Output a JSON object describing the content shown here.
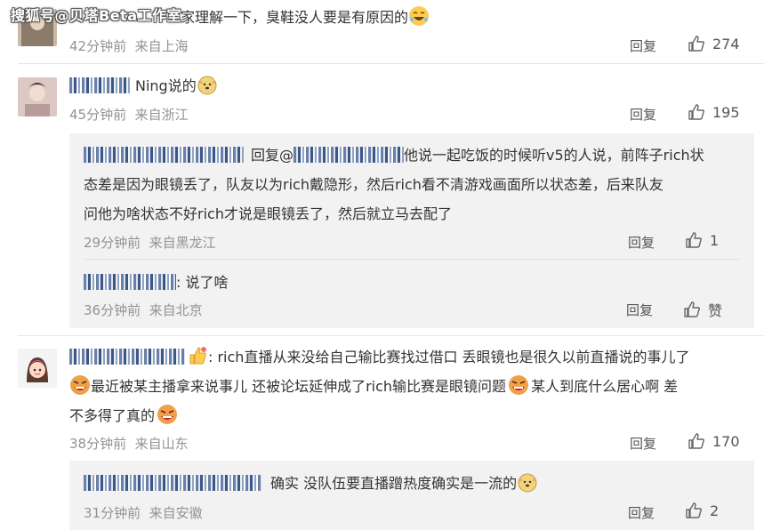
{
  "watermark": "搜狐号@贝塔Beta工作室",
  "actions": {
    "reply_label": "回复",
    "like_label": "赞"
  },
  "comments": [
    {
      "text": "家理解一下，臭鞋没人要是有原因的",
      "time": "42分钟前",
      "location": "来自上海",
      "likes": "274"
    },
    {
      "suffix": "Ning说的",
      "time": "45分钟前",
      "location": "来自浙江",
      "likes": "195",
      "replies": [
        {
          "reply_prefix": "回复@",
          "line1": "他说一起吃饭的时候听v5的人说，前阵子rich状",
          "line2": "态差是因为眼镜丢了，队友以为rich戴隐形，然后rich看不清游戏画面所以状态差，后来队友",
          "line3": "问他为啥状态不好rich才说是眼镜丢了，然后就立马去配了",
          "time": "29分钟前",
          "location": "来自黑龙江",
          "likes": "1"
        },
        {
          "text": ": 说了啥",
          "time": "36分钟前",
          "location": "来自北京"
        }
      ]
    },
    {
      "line1": ": rich直播从来没给自己输比赛找过借口 丢眼镜也是很久以前直播说的事儿了",
      "line2": "最近被某主播拿来说事儿 还被论坛延伸成了rich输比赛是眼镜问题",
      "line2b": "某人到底什么居心啊 差",
      "line3": "不多得了真的",
      "time": "38分钟前",
      "location": "来自山东",
      "likes": "170",
      "replies": [
        {
          "text": "确实 没队伍要直播蹭热度确实是一流的",
          "time": "31分钟前",
          "location": "来自安徽",
          "likes": "2"
        }
      ]
    }
  ]
}
